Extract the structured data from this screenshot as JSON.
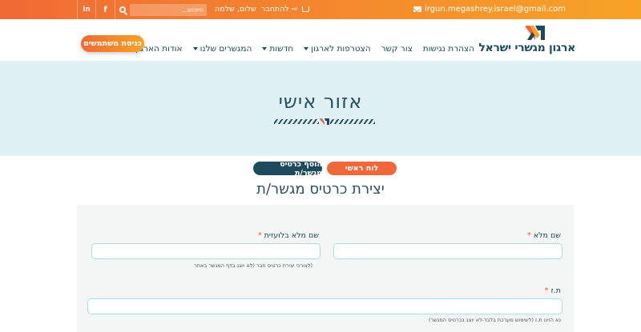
{
  "topbar": {
    "email": "irgun.megashrey.israel@gmail.com",
    "greeting": "שלום, שלמה",
    "login_link": "להתחבר",
    "search_placeholder": "חיפוש...",
    "social": {
      "facebook": "f",
      "linkedin": "in"
    }
  },
  "header": {
    "logo_text": "ארגון מגשרי ישראל",
    "nav": [
      {
        "label": "אודות הארגון",
        "dropdown": true
      },
      {
        "label": "המגשרים שלנו",
        "dropdown": true
      },
      {
        "label": "חדשות",
        "dropdown": true
      },
      {
        "label": "הצטרפות לארגון",
        "dropdown": true
      },
      {
        "label": "צור קשר",
        "dropdown": false
      },
      {
        "label": "הצהרת נגישות",
        "dropdown": false
      }
    ],
    "login_button": "כניסת משתמשים"
  },
  "hero": {
    "title": "אזור אישי"
  },
  "tabs": {
    "main": "לוח ראשי",
    "add_card": "הוסף כרטיס מגשר/ת"
  },
  "section_title": "יצירת כרטיס מגשר/ת",
  "form": {
    "full_name_label": "שם מלא",
    "full_name_latin_label": "שם מלא בלועזית",
    "full_name_latin_hint": "(לצורכי יצירת כרטיס חבר (לא יוצג בדף המגשר באתר",
    "id_label": "ת.ז",
    "id_hint": "נא הזינו ת.ז (לשימוש מערכת בלבד-לא יוצג בכרטיס המגשר)",
    "required_mark": "*"
  },
  "colors": {
    "orange": "#f0683a",
    "navy": "#1d4a5c",
    "hero_bg": "#dff1f5",
    "field_border": "#a9dce6"
  }
}
